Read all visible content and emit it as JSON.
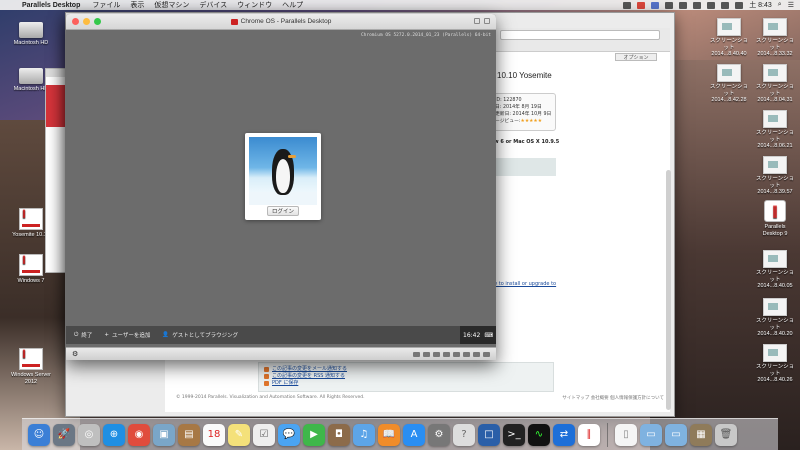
{
  "menubar": {
    "app_name": "Parallels Desktop",
    "items": [
      "ファイル",
      "表示",
      "仮想マシン",
      "デバイス",
      "ウィンドウ",
      "ヘルプ"
    ],
    "clock": "土 8:43"
  },
  "desktop_left": [
    {
      "label": "Macintosh HD"
    },
    {
      "label": "Macintosh HD"
    },
    {
      "label": "Yosemite 10.10"
    },
    {
      "label": "Windows 7"
    },
    {
      "label": "Windows Server 2012"
    }
  ],
  "desktop_right": [
    {
      "label": "スクリーンショット 2014...8.40.40"
    },
    {
      "label": "スクリーンショット 2014...8.33.32"
    },
    {
      "label": "スクリーンショット 2014...8.42.28"
    },
    {
      "label": "スクリーンショット 2014...8.04.31"
    },
    {
      "label": "スクリーンショット 2014...8.06.21"
    },
    {
      "label": "スクリーンショット 2014...8.39.57"
    },
    {
      "label": "Parallels Desktop 9"
    },
    {
      "label": "スクリーンショット 2014...8.40.05"
    },
    {
      "label": "スクリーンショット 2014...8.40.20"
    },
    {
      "label": "スクリーンショット 2014...8.40.26"
    }
  ],
  "vm_window": {
    "title": "Chrome OS - Parallels Desktop",
    "build_info": "Chromium OS 5272.0.2014_01_23 (Parallels) 64-bit",
    "login_button": "ログイン",
    "shelf": {
      "shutdown": "終了",
      "add_user": "ユーザーを追加",
      "guest": "ゲストとしてブラウジング",
      "clock": "16:42"
    }
  },
  "background_doc": {
    "option_button": "オプション",
    "title": "10.10 Yosemite",
    "info_lines": [
      "ID: 122870",
      "日: 2014年 8月 19日",
      "更新日: 2014年 10月 9日",
      "ージビュー:"
    ],
    "rating_stars": "★★★★★",
    "requirement": "w 6 or Mac OS X 10.9.5",
    "link": "ow to install or upgrade to",
    "subscribe": [
      "この記事の変更をメール通知する",
      "この記事の変更を RSS 通知する",
      "PDF に保存"
    ],
    "footer_left": "© 1999-2014 Parallels. Visualization and Automation Software. All Rights Reserved.",
    "footer_links": [
      "サイトマップ",
      "会社概要",
      "個人情報保護方針について"
    ]
  },
  "colors": {
    "accent_red": "#d5343b",
    "link_blue": "#1a4a9a"
  },
  "dock": [
    "finder",
    "launchpad",
    "safari-compass",
    "safari",
    "chrome",
    "preview",
    "contacts",
    "calendar",
    "notes",
    "reminders",
    "messages",
    "facetime",
    "photo-booth",
    "itunes",
    "ibooks",
    "app-store",
    "system-preferences",
    "help",
    "virtualbox",
    "terminal",
    "activity-monitor",
    "teamviewer",
    "parallels",
    "document",
    "folder",
    "folder",
    "photos",
    "trash"
  ]
}
